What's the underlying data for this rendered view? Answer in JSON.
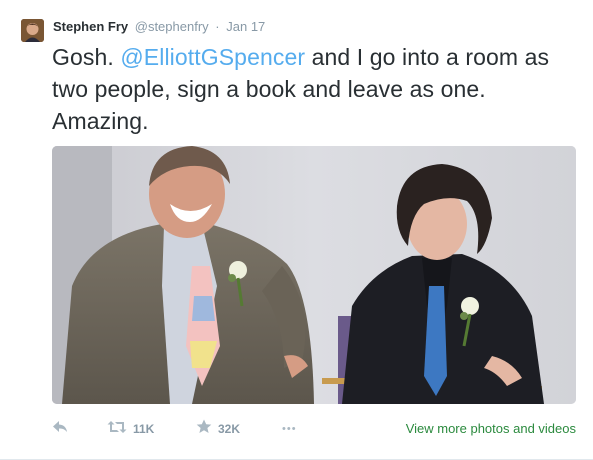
{
  "tweet": {
    "author_name": "Stephen Fry",
    "author_handle": "@stephenfry",
    "separator": "·",
    "timestamp": "Jan 17",
    "text_before": "Gosh. ",
    "mention": "@ElliottGSpencer",
    "text_after": " and I go into a room as two people, sign a book and leave as one. Amazing."
  },
  "actions": {
    "retweet_count": "11K",
    "favorite_count": "32K",
    "more_glyph": "•••",
    "view_more_label": "View more photos and videos"
  },
  "icons": {
    "reply": "reply-arrow-icon",
    "retweet": "retweet-icon",
    "favorite": "star-icon",
    "more": "ellipsis-icon"
  },
  "colors": {
    "mention": "#55acee",
    "muted": "#8899a6",
    "icon": "#aab8c2",
    "view_more_link": "#2b8a3e"
  }
}
